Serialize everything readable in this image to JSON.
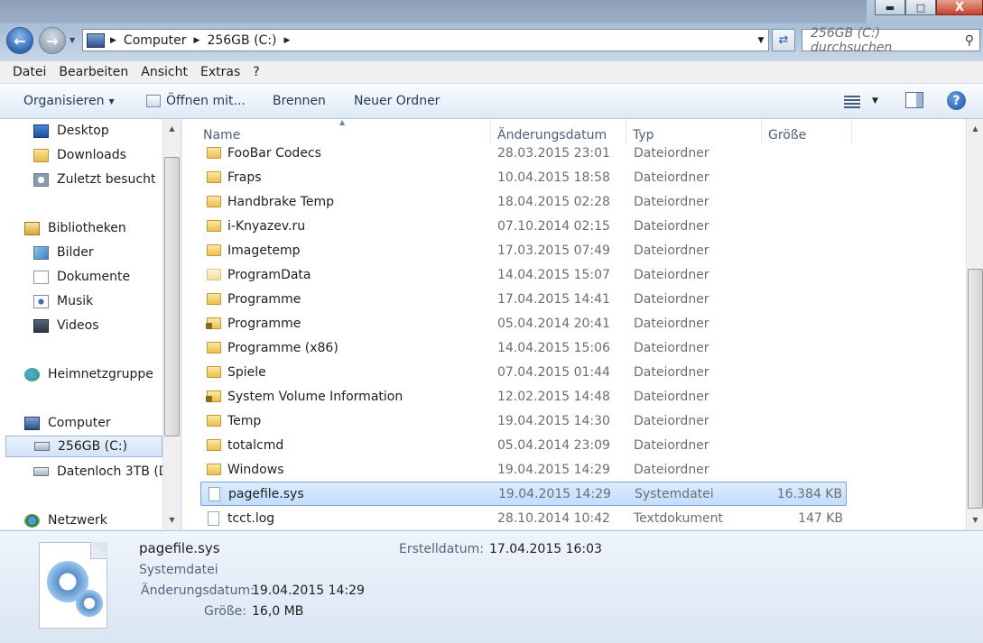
{
  "window": {
    "minimize_icon": "minimize-icon",
    "maximize_icon": "maximize-icon",
    "close_glyph": "X"
  },
  "address": {
    "crumbs": [
      "Computer",
      "256GB (C:)"
    ]
  },
  "search": {
    "placeholder": "256GB (C:) durchsuchen"
  },
  "menu": [
    "Datei",
    "Bearbeiten",
    "Ansicht",
    "Extras",
    "?"
  ],
  "toolbar": {
    "organize": "Organisieren",
    "open_with": "Öffnen mit...",
    "burn": "Brennen",
    "new_folder": "Neuer Ordner"
  },
  "nav": {
    "items": [
      {
        "label": "Desktop",
        "icon": "desktop-icon"
      },
      {
        "label": "Downloads",
        "icon": "folder-icon"
      },
      {
        "label": "Zuletzt besucht",
        "icon": "recent-places-icon"
      },
      {
        "label": "Bibliotheken",
        "icon": "libraries-icon"
      },
      {
        "label": "Bilder",
        "icon": "pictures-icon"
      },
      {
        "label": "Dokumente",
        "icon": "documents-icon"
      },
      {
        "label": "Musik",
        "icon": "music-icon"
      },
      {
        "label": "Videos",
        "icon": "videos-icon"
      },
      {
        "label": "Heimnetzgruppe",
        "icon": "homegroup-icon"
      },
      {
        "label": "Computer",
        "icon": "computer-icon"
      },
      {
        "label": "256GB (C:)",
        "icon": "drive-icon"
      },
      {
        "label": "Datenloch 3TB (D",
        "icon": "drive-icon"
      },
      {
        "label": "Netzwerk",
        "icon": "network-icon"
      }
    ]
  },
  "columns": {
    "name": "Name",
    "date": "Änderungsdatum",
    "type": "Typ",
    "size": "Größe"
  },
  "files": [
    {
      "name": "FooBar Codecs",
      "date": "28.03.2015 23:01",
      "type": "Dateiordner",
      "size": "",
      "icon": "folder-icon"
    },
    {
      "name": "Fraps",
      "date": "10.04.2015 18:58",
      "type": "Dateiordner",
      "size": "",
      "icon": "folder-icon"
    },
    {
      "name": "Handbrake Temp",
      "date": "18.04.2015 02:28",
      "type": "Dateiordner",
      "size": "",
      "icon": "folder-icon"
    },
    {
      "name": "i-Knyazev.ru",
      "date": "07.10.2014 02:15",
      "type": "Dateiordner",
      "size": "",
      "icon": "folder-icon"
    },
    {
      "name": "Imagetemp",
      "date": "17.03.2015 07:49",
      "type": "Dateiordner",
      "size": "",
      "icon": "folder-icon"
    },
    {
      "name": "ProgramData",
      "date": "14.04.2015 15:07",
      "type": "Dateiordner",
      "size": "",
      "icon": "hidden-folder-icon"
    },
    {
      "name": "Programme",
      "date": "17.04.2015 14:41",
      "type": "Dateiordner",
      "size": "",
      "icon": "folder-icon"
    },
    {
      "name": "Programme",
      "date": "05.04.2014 20:41",
      "type": "Dateiordner",
      "size": "",
      "icon": "locked-folder-icon"
    },
    {
      "name": "Programme (x86)",
      "date": "14.04.2015 15:06",
      "type": "Dateiordner",
      "size": "",
      "icon": "folder-icon"
    },
    {
      "name": "Spiele",
      "date": "07.04.2015 01:44",
      "type": "Dateiordner",
      "size": "",
      "icon": "folder-icon"
    },
    {
      "name": "System Volume Information",
      "date": "12.02.2015 14:48",
      "type": "Dateiordner",
      "size": "",
      "icon": "locked-folder-icon"
    },
    {
      "name": "Temp",
      "date": "19.04.2015 14:30",
      "type": "Dateiordner",
      "size": "",
      "icon": "folder-icon"
    },
    {
      "name": "totalcmd",
      "date": "05.04.2014 23:09",
      "type": "Dateiordner",
      "size": "",
      "icon": "folder-icon"
    },
    {
      "name": "Windows",
      "date": "19.04.2015 14:29",
      "type": "Dateiordner",
      "size": "",
      "icon": "folder-icon"
    },
    {
      "name": "pagefile.sys",
      "date": "19.04.2015 14:29",
      "type": "Systemdatei",
      "size": "16.384 KB",
      "icon": "system-file-icon",
      "selected": true
    },
    {
      "name": "tcct.log",
      "date": "28.10.2014 10:42",
      "type": "Textdokument",
      "size": "147 KB",
      "icon": "text-file-icon"
    }
  ],
  "details": {
    "filename": "pagefile.sys",
    "filetype": "Systemdatei",
    "modified_label": "Änderungsdatum:",
    "modified_value": "19.04.2015 14:29",
    "size_label": "Größe:",
    "size_value": "16,0 MB",
    "created_label": "Erstelldatum:",
    "created_value": "17.04.2015 16:03"
  }
}
